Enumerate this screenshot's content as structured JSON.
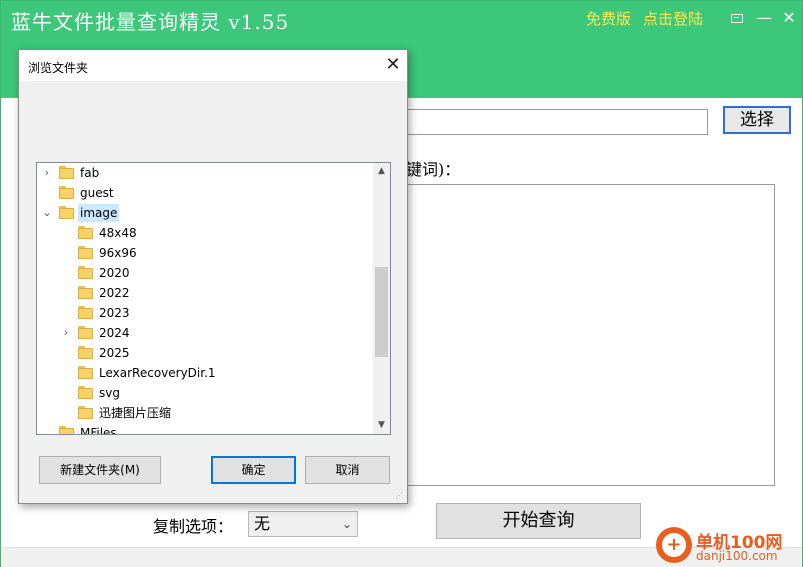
{
  "app": {
    "title": "蓝牛文件批量查询精灵  v1.55",
    "free_label": "免费版",
    "login_label": "点击登陆",
    "choose_button": "选择",
    "keyword_label": "键词)：",
    "copy_option_label": "复制选项：",
    "copy_option_value": "无",
    "start_button": "开始查询"
  },
  "dialog": {
    "title": "浏览文件夹",
    "tree": [
      {
        "label": "fab",
        "expander": "›"
      },
      {
        "label": "guest",
        "expander": ""
      },
      {
        "label": "image",
        "expander": "⌄",
        "selected": true
      },
      {
        "label": "48x48",
        "expander": ""
      },
      {
        "label": "96x96",
        "expander": ""
      },
      {
        "label": "2020",
        "expander": ""
      },
      {
        "label": "2022",
        "expander": ""
      },
      {
        "label": "2023",
        "expander": ""
      },
      {
        "label": "2024",
        "expander": "›"
      },
      {
        "label": "2025",
        "expander": ""
      },
      {
        "label": "LexarRecoveryDir.1",
        "expander": ""
      },
      {
        "label": "svg",
        "expander": ""
      },
      {
        "label": "迅捷图片压缩",
        "expander": ""
      },
      {
        "label": "MFiles",
        "expander": ""
      }
    ],
    "new_folder_button": "新建文件夹(M)",
    "ok_button": "确定",
    "cancel_button": "取消"
  },
  "watermark": {
    "name": "单机100网",
    "url": "danji100.com"
  },
  "colors": {
    "titlebar": "#3cc77a",
    "accent_yellow": "#ffe84a",
    "selection": "#cce8ff",
    "watermark": "#e85e1f"
  }
}
